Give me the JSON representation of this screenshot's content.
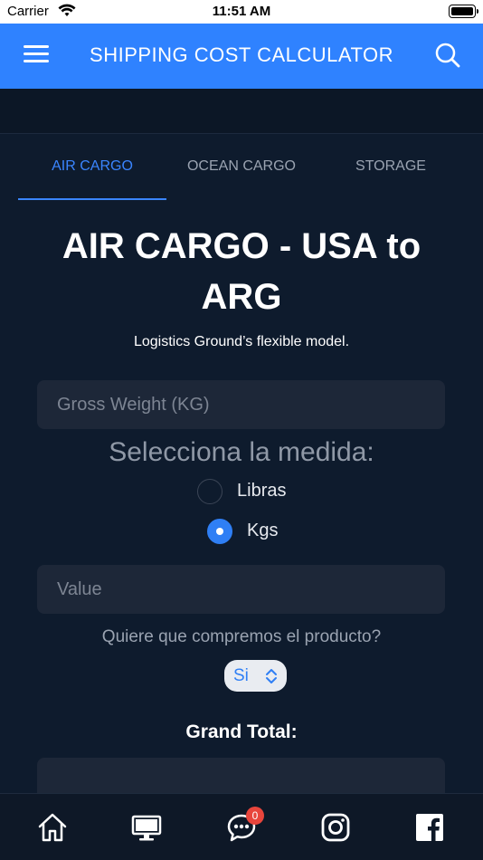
{
  "status_bar": {
    "carrier": "Carrier",
    "time": "11:51 AM"
  },
  "header": {
    "title": "SHIPPING COST CALCULATOR"
  },
  "tabs": [
    {
      "label": "AIR CARGO",
      "active": true
    },
    {
      "label": "OCEAN CARGO",
      "active": false
    },
    {
      "label": "STORAGE",
      "active": false
    }
  ],
  "main": {
    "title": "AIR CARGO - USA to ARG",
    "subtitle": "Logistics Ground’s flexible model.",
    "gross_weight_placeholder": "Gross Weight (KG)",
    "measure_label": "Selecciona la medida:",
    "radio_options": [
      {
        "label": "Libras",
        "checked": false
      },
      {
        "label": "Kgs",
        "checked": true
      }
    ],
    "value_placeholder": "Value",
    "buy_question": "Quiere que compremos el producto?",
    "buy_select_value": "Si",
    "grand_total_label": "Grand Total:"
  },
  "bottom_nav": {
    "chat_badge": "0",
    "icons": [
      "home-icon",
      "desktop-icon",
      "chat-icon",
      "instagram-icon",
      "facebook-icon"
    ]
  },
  "colors": {
    "header_bg": "#2f82ff",
    "page_bg": "#0e1b2d",
    "accent": "#3a85ff",
    "badge": "#e8453c"
  }
}
